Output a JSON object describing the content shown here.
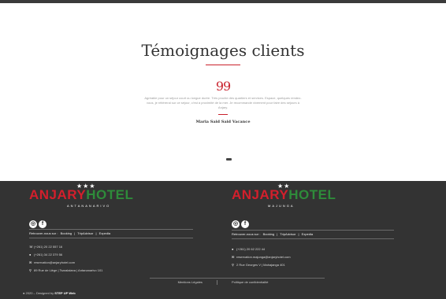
{
  "testimonials": {
    "title": "Témoignages clients",
    "quote_mark": "99",
    "quote_text": "Agréable pour un séjour court ou longue durée. Très proche des quartiers et services. Espace, quelques rendez-vous, je réitèrerai sur ce séjour, c'est à proximité de la mer. Je recommande vivement pour faire des séjours à Anjary.",
    "author": "Maria Said Said Vacance"
  },
  "footer": {
    "left": {
      "stars": "★★★",
      "brand_a": "ANJARY",
      "brand_b": "HOTEL",
      "city": "ANTANANARIVO",
      "links_label": "Retrouver-nous sur :",
      "links": [
        "Booking",
        "|",
        "TripAdvisor",
        "|",
        "Expedia"
      ],
      "contacts": [
        {
          "icon": "phone-icon",
          "glyph": "☏",
          "text": "(+261) 20 22 557 16"
        },
        {
          "icon": "whatsapp-icon",
          "glyph": "●",
          "text": "(+261) 34 22 379 56"
        },
        {
          "icon": "mail-icon",
          "glyph": "✉",
          "text": "reservation@anjaryhotel.com"
        },
        {
          "icon": "location-icon",
          "glyph": "⚲",
          "text": "89 Rue de Liège | Tsaralalana | Antananarivo 101"
        }
      ]
    },
    "right": {
      "stars": "★★",
      "brand_a": "ANJARY",
      "brand_b": "HOTEL",
      "city": "MAJUNGA",
      "links_label": "Retrouver-nous sur :",
      "links": [
        "Booking",
        "|",
        "TripAdvisor",
        "|",
        "Expedia"
      ],
      "contacts": [
        {
          "icon": "whatsapp-icon",
          "glyph": "●",
          "text": "(+261) 20 62 222 44"
        },
        {
          "icon": "mail-icon",
          "glyph": "✉",
          "text": "reservation.majunga@anjaryhotel.com"
        },
        {
          "icon": "location-icon",
          "glyph": "⚲",
          "text": "2 Rue Georges V | Mahajanga 401"
        }
      ]
    },
    "legal": [
      "Mentions Légales",
      "Politique de confidentialité"
    ],
    "copyright_prefix": "2020 – Designed by",
    "copyright_brand": "STEP UP Web"
  }
}
